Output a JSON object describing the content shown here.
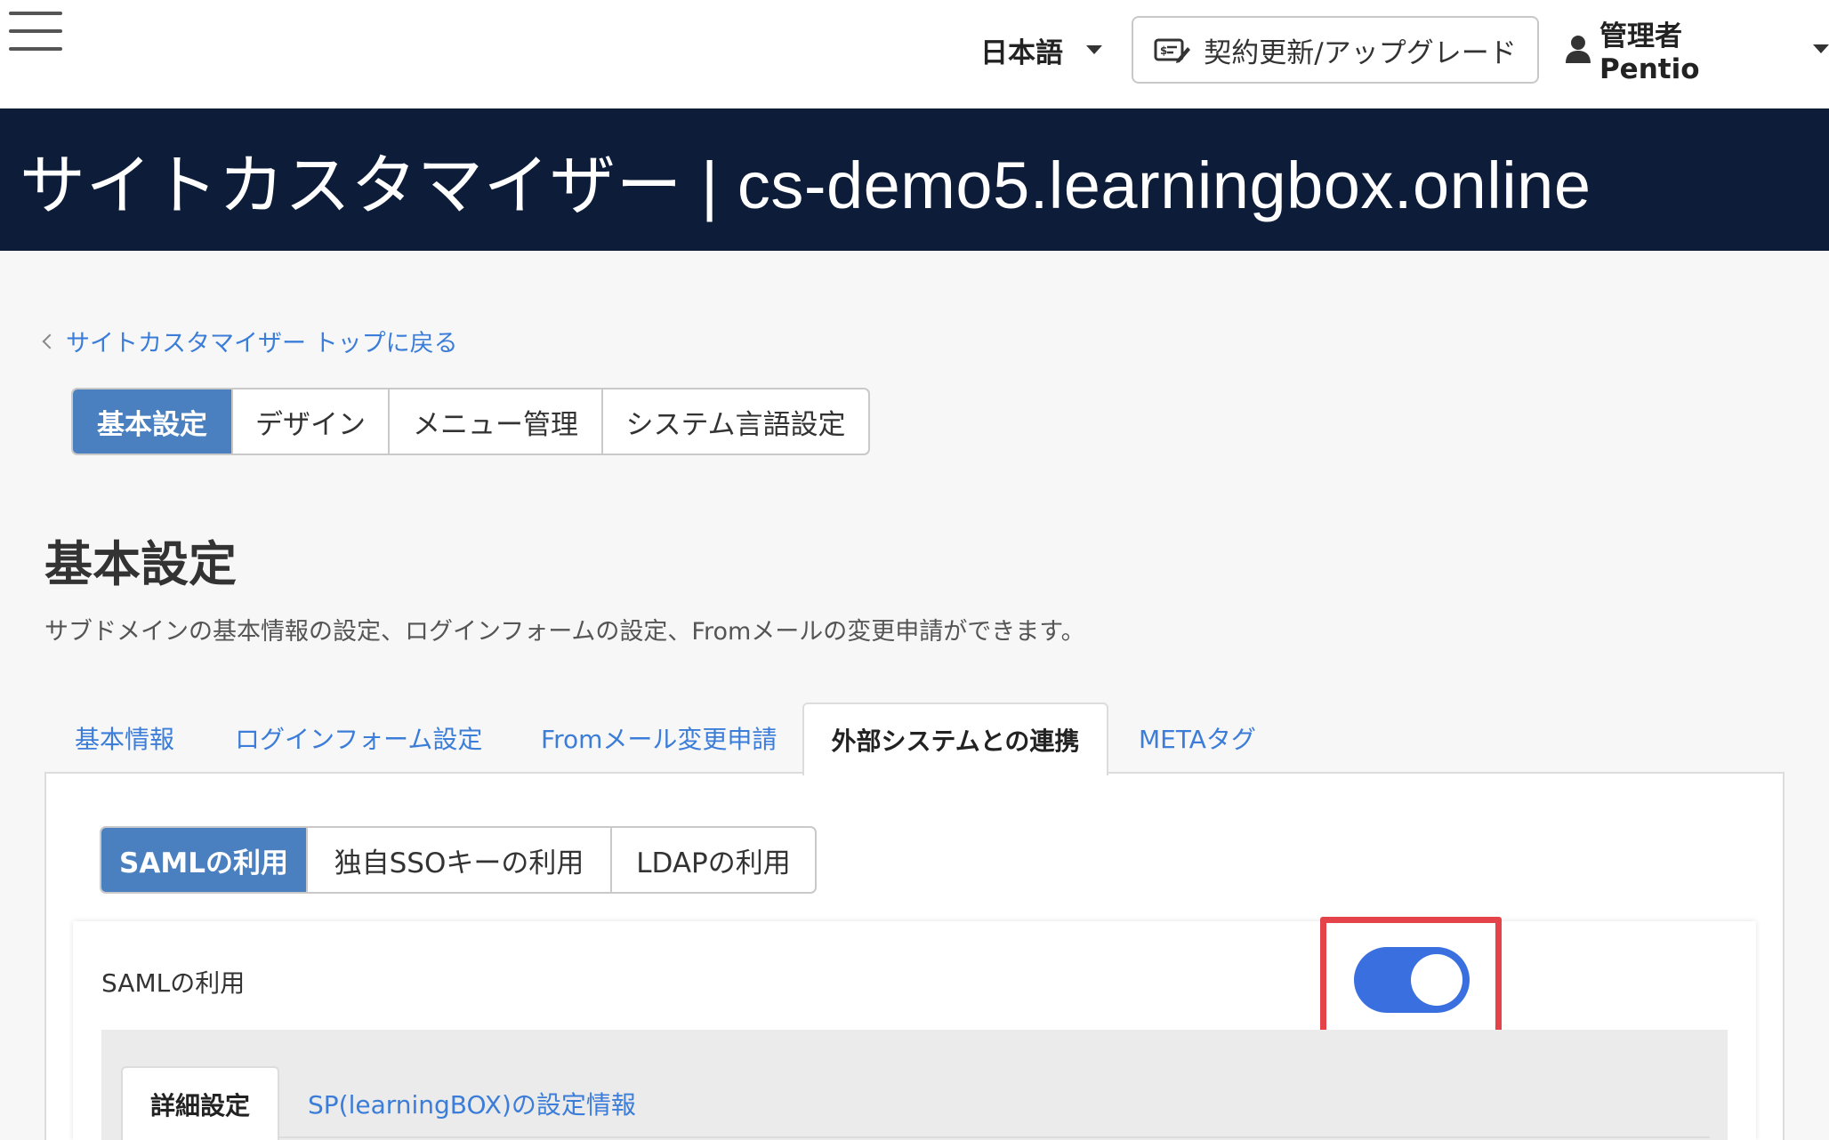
{
  "topbar": {
    "menu_icon": "hamburger-menu-icon",
    "language": "日本語",
    "upgrade_label": "契約更新/アップグレード",
    "upgrade_icon": "contract-edit-icon",
    "user_label": "管理者 Pentio",
    "user_icon": "person-icon"
  },
  "banner": {
    "title": "サイトカスタマイザー | cs-demo5.learningbox.online",
    "background": "#0c1c39"
  },
  "back_link": "サイトカスタマイザー トップに戻る",
  "main_tabs": [
    {
      "label": "基本設定",
      "active": true
    },
    {
      "label": "デザイン",
      "active": false
    },
    {
      "label": "メニュー管理",
      "active": false
    },
    {
      "label": "システム言語設定",
      "active": false
    }
  ],
  "page": {
    "title": "基本設定",
    "description": "サブドメインの基本情報の設定、ログインフォームの設定、Fromメールの変更申請ができます。"
  },
  "section_tabs": [
    {
      "label": "基本情報",
      "active": false
    },
    {
      "label": "ログインフォーム設定",
      "active": false
    },
    {
      "label": "Fromメール変更申請",
      "active": false
    },
    {
      "label": "外部システムとの連携",
      "active": true
    },
    {
      "label": "METAタグ",
      "active": false
    }
  ],
  "integration_tabs": [
    {
      "label": "SAMLの利用",
      "active": true
    },
    {
      "label": "独自SSOキーの利用",
      "active": false
    },
    {
      "label": "LDAPの利用",
      "active": false
    }
  ],
  "saml": {
    "label": "SAMLの利用",
    "enabled": true,
    "toggle_color": "#3a6fe0",
    "highlight_color": "#e4434a"
  },
  "detail_tabs": [
    {
      "label": "詳細設定",
      "active": true
    },
    {
      "label": "SP(learningBOX)の設定情報",
      "active": false
    }
  ],
  "colors": {
    "accent": "#4a80c0",
    "link": "#3b7dd8"
  }
}
